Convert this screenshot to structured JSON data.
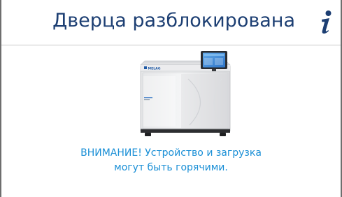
{
  "header": {
    "title": "Дверца разблокирована",
    "info_icon": "info-icon"
  },
  "device": {
    "brand": "MELAG",
    "image_icon": "autoclave-illustration"
  },
  "message": {
    "line1": "ВНИМАНИЕ! Устройство и загрузка",
    "line2": "могут быть горячими."
  },
  "colors": {
    "title": "#1d3f73",
    "warning": "#1a8fd6",
    "frame": "#6e6e6e",
    "divider": "#c8c8c8"
  }
}
